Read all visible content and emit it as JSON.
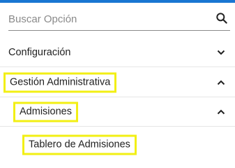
{
  "search": {
    "placeholder": "Buscar Opción",
    "icon": "search-icon"
  },
  "menu": [
    {
      "label": "Configuración",
      "icon": "chevron-down-icon",
      "expanded": false
    },
    {
      "label": "Gestión Administrativa",
      "icon": "chevron-up-icon",
      "expanded": true,
      "highlighted": true
    },
    {
      "label": "Admisiones",
      "icon": "chevron-up-icon",
      "expanded": true,
      "highlighted": true
    },
    {
      "label": "Tablero de Admisiones",
      "highlighted": true
    }
  ],
  "colors": {
    "accent": "#1976d2",
    "highlight_border": "#f2ef14"
  }
}
